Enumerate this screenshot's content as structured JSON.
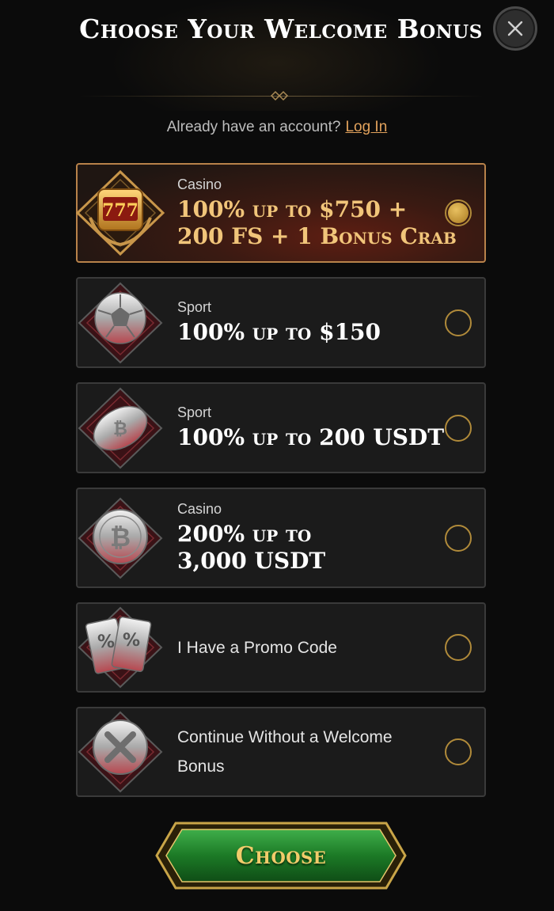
{
  "modal": {
    "title": "Choose Your Welcome Bonus",
    "close_icon": "close-icon"
  },
  "login": {
    "prompt": "Already have an account?",
    "link": "Log In"
  },
  "options": [
    {
      "category": "Casino",
      "offer_line1": "100% up to $750 +",
      "offer_line2": "200 FS + 1 Bonus Crab",
      "icon": "slot-777-icon",
      "selected": true
    },
    {
      "category": "Sport",
      "offer_line1": "100% up to $150",
      "icon": "soccer-ball-icon",
      "selected": false
    },
    {
      "category": "Sport",
      "offer_line1": "100% up to 200 USDT",
      "icon": "bitcoin-football-icon",
      "selected": false
    },
    {
      "category": "Casino",
      "offer_line1": "200% up to",
      "offer_line2": "3,000 USDT",
      "icon": "bitcoin-coin-icon",
      "selected": false
    },
    {
      "label": "I Have a Promo Code",
      "icon": "promo-code-icon",
      "selected": false
    },
    {
      "label_line1": "Continue Without a Welcome",
      "label_line2": "Bonus",
      "icon": "no-bonus-icon",
      "selected": false
    }
  ],
  "actions": {
    "choose_label": "Choose"
  },
  "colors": {
    "accent_gold": "#e2a25c",
    "selected_border": "#b8824a",
    "button_green": "#1f7a2a"
  }
}
